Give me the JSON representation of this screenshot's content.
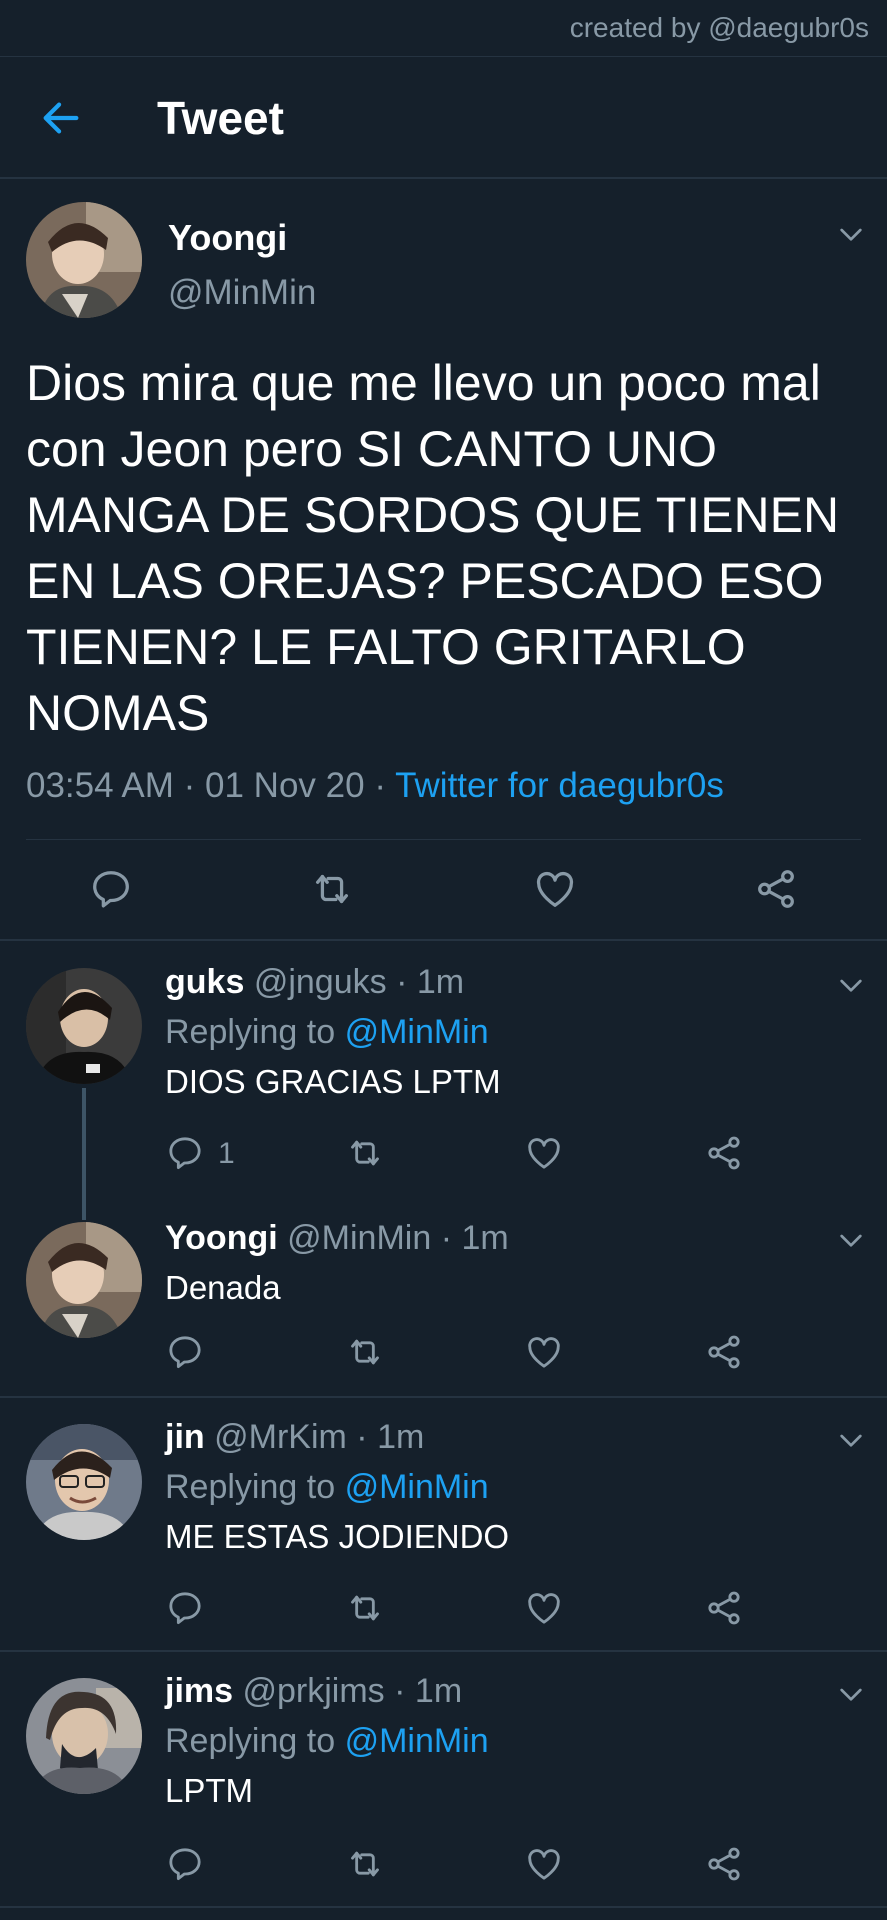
{
  "watermark": "created by @daegubr0s",
  "header": {
    "title": "Tweet"
  },
  "main_tweet": {
    "name": "Yoongi",
    "handle": "@MinMin",
    "text": "Dios mira que me llevo un poco mal con Jeon pero SI CANTO UNO MANGA DE SORDOS QUE TIENEN EN LAS OREJAS? PESCADO ESO TIENEN? LE FALTO GRITARLO NOMAS",
    "time": "03:54 AM",
    "date": "01 Nov 20",
    "source": "Twitter for daegubr0s"
  },
  "replies": [
    {
      "name": "guks",
      "handle": "@jnguks",
      "time": "1m",
      "replying_label": "Replying to",
      "replying_to": "@MinMin",
      "text": "DIOS GRACIAS LPTM",
      "reply_count": "1"
    },
    {
      "name": "Yoongi",
      "handle": "@MinMin",
      "time": "1m",
      "text": "Denada"
    },
    {
      "name": "jin",
      "handle": "@MrKim",
      "time": "1m",
      "replying_label": "Replying to",
      "replying_to": "@MinMin",
      "text": "ME ESTAS JODIENDO"
    },
    {
      "name": "jims",
      "handle": "@prkjims",
      "time": "1m",
      "replying_label": "Replying to",
      "replying_to": "@MinMin",
      "text": "LPTM"
    }
  ],
  "colors": {
    "background": "#15202b",
    "accent": "#1da1f2",
    "muted": "#8899a6",
    "divider": "#253341"
  },
  "icons": [
    "back-arrow-icon",
    "chevron-down-icon",
    "reply-icon",
    "retweet-icon",
    "like-icon",
    "share-icon"
  ]
}
